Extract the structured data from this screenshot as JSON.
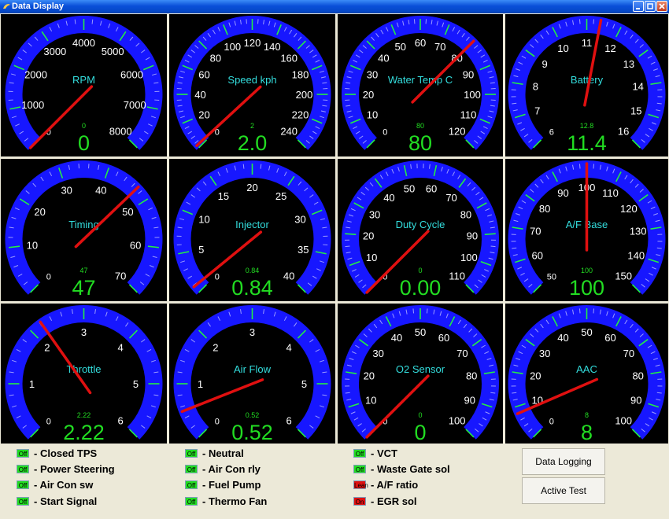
{
  "window": {
    "title": "Data Display"
  },
  "gauges": [
    {
      "label": "RPM",
      "ticks": [
        "0",
        "1000",
        "2000",
        "3000",
        "4000",
        "5000",
        "6000",
        "7000",
        "8000"
      ],
      "min": 0,
      "max": 8000,
      "small_value": "0",
      "value": "0",
      "needle_value": 0
    },
    {
      "label": "Speed kph",
      "ticks": [
        "0",
        "20",
        "40",
        "60",
        "80",
        "100",
        "120",
        "140",
        "160",
        "180",
        "200",
        "220",
        "240"
      ],
      "min": 0,
      "max": 240,
      "small_value": "2",
      "value": "2.0",
      "needle_value": 2
    },
    {
      "label": "Water Temp C",
      "ticks": [
        "0",
        "10",
        "20",
        "30",
        "40",
        "50",
        "60",
        "70",
        "80",
        "90",
        "100",
        "110",
        "120"
      ],
      "min": 0,
      "max": 120,
      "small_value": "80",
      "value": "80",
      "needle_value": 80
    },
    {
      "label": "Battery",
      "ticks": [
        "6",
        "7",
        "8",
        "9",
        "10",
        "11",
        "12",
        "13",
        "14",
        "15",
        "16"
      ],
      "min": 6,
      "max": 16,
      "small_value": "12.8",
      "value": "11.4",
      "needle_value": 11.4
    },
    {
      "label": "Timing",
      "ticks": [
        "0",
        "10",
        "20",
        "30",
        "40",
        "50",
        "60",
        "70"
      ],
      "min": 0,
      "max": 70,
      "small_value": "47",
      "value": "47",
      "needle_value": 47
    },
    {
      "label": "Injector",
      "ticks": [
        "0",
        "5",
        "10",
        "15",
        "20",
        "25",
        "30",
        "35",
        "40"
      ],
      "min": 0,
      "max": 40,
      "small_value": "0.84",
      "value": "0.84",
      "needle_value": 0.84
    },
    {
      "label": "Duty Cycle",
      "ticks": [
        "0",
        "10",
        "20",
        "30",
        "40",
        "50",
        "60",
        "70",
        "80",
        "90",
        "100",
        "110"
      ],
      "min": 0,
      "max": 110,
      "small_value": "0",
      "value": "0.00",
      "needle_value": 0
    },
    {
      "label": "A/F Base",
      "ticks": [
        "50",
        "60",
        "70",
        "80",
        "90",
        "100",
        "110",
        "120",
        "130",
        "140",
        "150"
      ],
      "min": 50,
      "max": 150,
      "small_value": "100",
      "value": "100",
      "needle_value": 100
    },
    {
      "label": "Throttle",
      "ticks": [
        "0",
        "1",
        "2",
        "3",
        "4",
        "5",
        "6"
      ],
      "min": 0,
      "max": 6,
      "small_value": "2.22",
      "value": "2.22",
      "needle_value": 2.22
    },
    {
      "label": "Air Flow",
      "ticks": [
        "0",
        "1",
        "2",
        "3",
        "4",
        "5",
        "6"
      ],
      "min": 0,
      "max": 6,
      "small_value": "0.52",
      "value": "0.52",
      "needle_value": 0.52
    },
    {
      "label": "O2 Sensor",
      "ticks": [
        "0",
        "10",
        "20",
        "30",
        "40",
        "50",
        "60",
        "70",
        "80",
        "90",
        "100"
      ],
      "min": 0,
      "max": 100,
      "small_value": "0",
      "value": "0",
      "needle_value": 0
    },
    {
      "label": "AAC",
      "ticks": [
        "0",
        "10",
        "20",
        "30",
        "40",
        "50",
        "60",
        "70",
        "80",
        "90",
        "100"
      ],
      "min": 0,
      "max": 100,
      "small_value": "8",
      "value": "8",
      "needle_value": 8
    }
  ],
  "indicators": [
    {
      "state": "Off",
      "state_color": "#22dd22",
      "label": "- Closed TPS"
    },
    {
      "state": "Off",
      "state_color": "#22dd22",
      "label": "- Power Steering"
    },
    {
      "state": "Off",
      "state_color": "#22dd22",
      "label": "- Air Con sw"
    },
    {
      "state": "Off",
      "state_color": "#22dd22",
      "label": "- Start Signal"
    },
    {
      "state": "Off",
      "state_color": "#22dd22",
      "label": "- Neutral"
    },
    {
      "state": "Off",
      "state_color": "#22dd22",
      "label": "- Air Con rly"
    },
    {
      "state": "Off",
      "state_color": "#22dd22",
      "label": "- Fuel Pump"
    },
    {
      "state": "Off",
      "state_color": "#22dd22",
      "label": "- Thermo Fan"
    },
    {
      "state": "Off",
      "state_color": "#22dd22",
      "label": "- VCT"
    },
    {
      "state": "Off",
      "state_color": "#22dd22",
      "label": "- Waste Gate sol"
    },
    {
      "state": "Lean",
      "state_color": "#dd1111",
      "label": "- A/F ratio"
    },
    {
      "state": "On",
      "state_color": "#dd1111",
      "label": "- EGR sol"
    }
  ],
  "buttons": {
    "data_logging": "Data Logging",
    "active_test": "Active Test"
  },
  "colors": {
    "dial_blue": "#1717ff",
    "minor_tick": "#9b9bff",
    "major_tick": "#22ee44",
    "label_cyan": "#33dddd",
    "value_green": "#22dd22",
    "needle": "#e01010"
  }
}
